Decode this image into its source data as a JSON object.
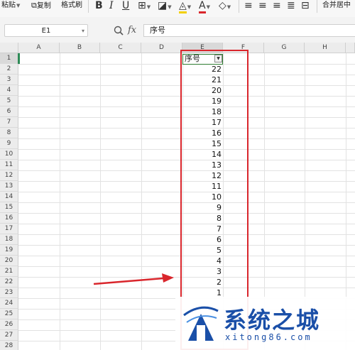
{
  "toolbar": {
    "paste": "粘贴",
    "copy": "复制",
    "format_painter": "格式刷",
    "bold": "B",
    "italic": "I",
    "underline": "U",
    "font_color": "A",
    "merge_center": "合并居中"
  },
  "formula_bar": {
    "cell_ref": "E1",
    "fx": "fx",
    "value": "序号"
  },
  "columns": [
    "A",
    "B",
    "C",
    "D",
    "E",
    "F",
    "G",
    "H"
  ],
  "rows": [
    "1",
    "2",
    "3",
    "4",
    "5",
    "6",
    "7",
    "8",
    "9",
    "10",
    "11",
    "12",
    "13",
    "14",
    "15",
    "16",
    "17",
    "18",
    "19",
    "20",
    "21",
    "22",
    "23",
    "24",
    "25",
    "26",
    "27",
    "28"
  ],
  "column_e": {
    "header": "序号",
    "values": [
      "22",
      "21",
      "20",
      "19",
      "18",
      "17",
      "16",
      "15",
      "14",
      "13",
      "12",
      "11",
      "10",
      "9",
      "8",
      "7",
      "6",
      "5",
      "4",
      "3",
      "2",
      "1"
    ]
  },
  "watermark": {
    "title": "系统之城",
    "url": "xitong86.com"
  },
  "colors": {
    "highlight": "#d9262c",
    "selection": "#2f7d32",
    "watermark": "#1a4fa8"
  }
}
